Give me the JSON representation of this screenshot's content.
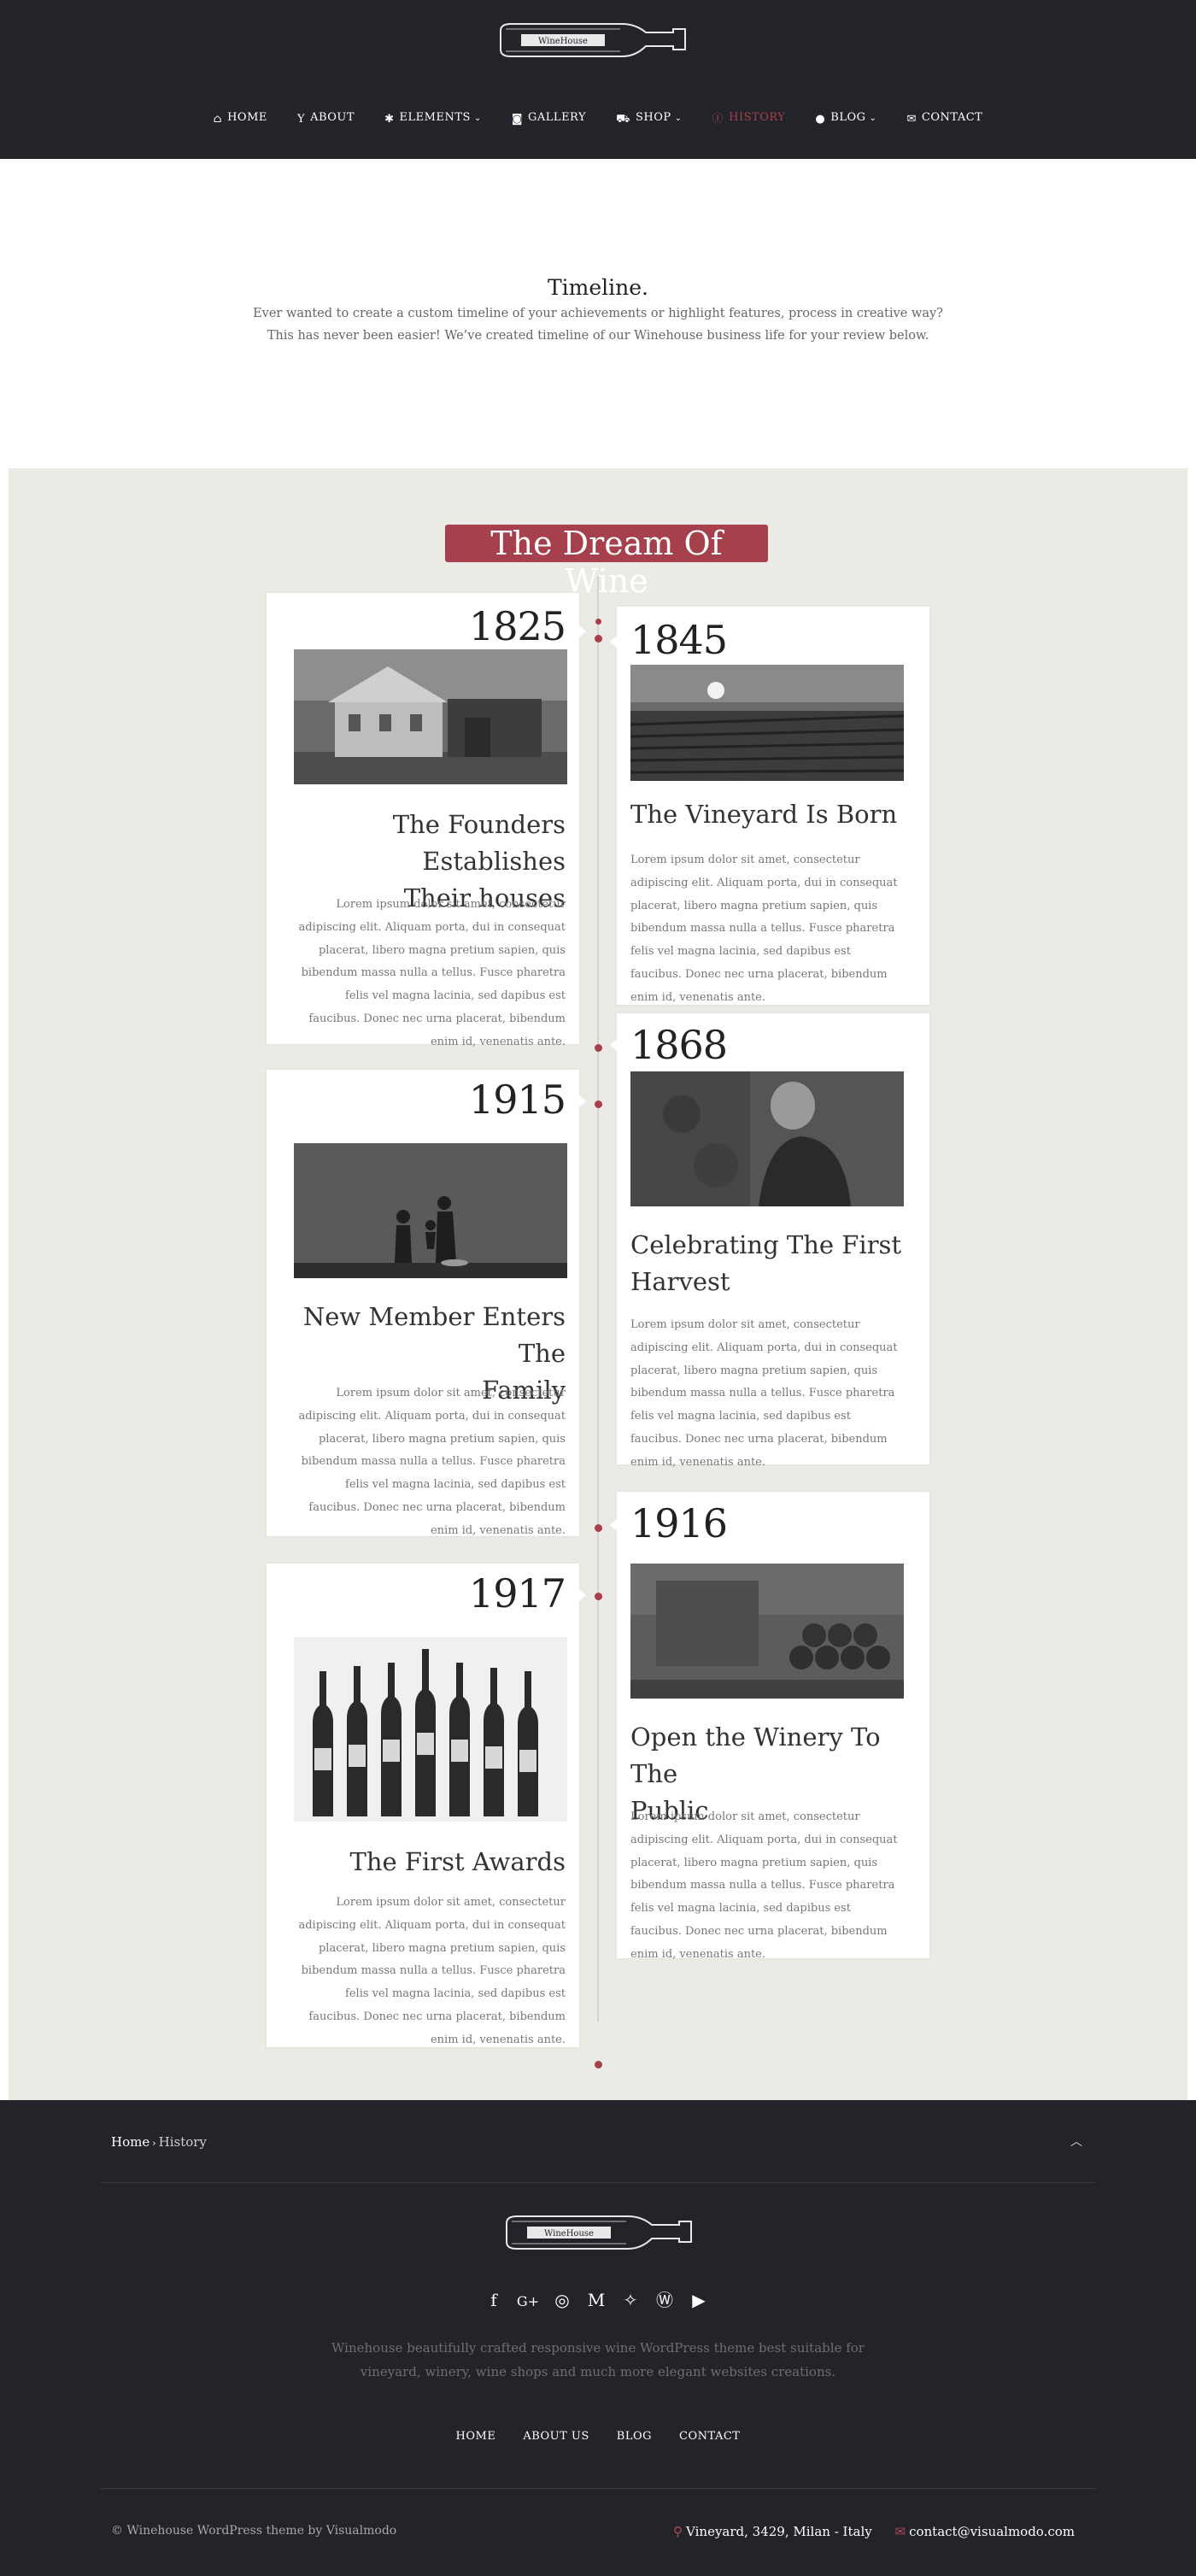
{
  "brand": {
    "logo_text": "WineHouse"
  },
  "nav": {
    "items": [
      {
        "label": "HOME",
        "icon": "home-icon"
      },
      {
        "label": "ABOUT",
        "icon": "glass-icon"
      },
      {
        "label": "ELEMENTS",
        "icon": "gear-icon",
        "has_dropdown": true
      },
      {
        "label": "GALLERY",
        "icon": "camera-icon"
      },
      {
        "label": "SHOP",
        "icon": "cart-icon",
        "has_dropdown": true
      },
      {
        "label": "HISTORY",
        "icon": "info-icon",
        "active": true
      },
      {
        "label": "BLOG",
        "icon": "comment-icon",
        "has_dropdown": true
      },
      {
        "label": "CONTACT",
        "icon": "envelope-icon"
      }
    ],
    "active_color": "#a6404d"
  },
  "intro": {
    "title": "Timeline.",
    "line1": "Ever wanted to create a custom timeline of your achievements or highlight features, process in creative way?",
    "line2": "This has never been easier! We’ve created timeline of our Winehouse business life for your review below."
  },
  "timeline": {
    "heading": "The Dream Of Wine",
    "accent_color": "#a6404d",
    "events": [
      {
        "year": "1825",
        "title_line1": "The Founders Establishes",
        "title_line2": "Their houses",
        "image": "farmhouse-photo",
        "text": "Lorem ipsum dolor sit amet, consectetur adipiscing elit. Aliquam porta, dui in consequat placerat, libero magna pretium sapien, quis bibendum massa nulla a tellus. Fusce pharetra felis vel magna lacinia, sed dapibus est faucibus. Donec nec urna placerat, bibendum enim id, venenatis ante."
      },
      {
        "year": "1845",
        "title_line1": "The Vineyard Is Born",
        "title_line2": "",
        "image": "vineyard-sunset-photo",
        "text": "Lorem ipsum dolor sit amet, consectetur adipiscing elit. Aliquam porta, dui in consequat placerat, libero magna pretium sapien, quis bibendum massa nulla a tellus. Fusce pharetra felis vel magna lacinia, sed dapibus est faucibus. Donec nec urna placerat, bibendum enim id, venenatis ante."
      },
      {
        "year": "1868",
        "title_line1": "Celebrating The First",
        "title_line2": "Harvest",
        "image": "harvest-photo",
        "text": "Lorem ipsum dolor sit amet, consectetur adipiscing elit. Aliquam porta, dui in consequat placerat, libero magna pretium sapien, quis bibendum massa nulla a tellus. Fusce pharetra felis vel magna lacinia, sed dapibus est faucibus. Donec nec urna placerat, bibendum enim id, venenatis ante."
      },
      {
        "year": "1915",
        "title_line1": "New Member Enters The",
        "title_line2": "Family",
        "image": "family-silhouette-photo",
        "text": "Lorem ipsum dolor sit amet, consectetur adipiscing elit. Aliquam porta, dui in consequat placerat, libero magna pretium sapien, quis bibendum massa nulla a tellus. Fusce pharetra felis vel magna lacinia, sed dapibus est faucibus. Donec nec urna placerat, bibendum enim id, venenatis ante."
      },
      {
        "year": "1916",
        "title_line1": "Open the Winery To The",
        "title_line2": "Public",
        "image": "wine-cellar-photo",
        "text": "Lorem ipsum dolor sit amet, consectetur adipiscing elit. Aliquam porta, dui in consequat placerat, libero magna pretium sapien, quis bibendum massa nulla a tellus. Fusce pharetra felis vel magna lacinia, sed dapibus est faucibus. Donec nec urna placerat, bibendum enim id, venenatis ante."
      },
      {
        "year": "1917",
        "title_line1": "The First Awards",
        "title_line2": "",
        "image": "wine-bottles-photo",
        "text": "Lorem ipsum dolor sit amet, consectetur adipiscing elit. Aliquam porta, dui in consequat placerat, libero magna pretium sapien, quis bibendum massa nulla a tellus. Fusce pharetra felis vel magna lacinia, sed dapibus est faucibus. Donec nec urna placerat, bibendum enim id, venenatis ante."
      }
    ]
  },
  "footer": {
    "breadcrumb": {
      "home": "Home",
      "separator": "›",
      "current": "History"
    },
    "to_top_icon": "chevron-up-icon",
    "social": [
      "facebook-icon",
      "google-plus-icon",
      "instagram-icon",
      "medium-icon",
      "twitter-icon",
      "wordpress-icon",
      "youtube-icon"
    ],
    "about_line1": "Winehouse beautifully crafted responsive wine WordPress theme best suitable for",
    "about_line2": "vineyard, winery, wine shops and much more elegant websites creations.",
    "nav": [
      "HOME",
      "ABOUT US",
      "BLOG",
      "CONTACT"
    ],
    "copyright": "© Winehouse WordPress theme by Visualmodo",
    "address": "Vineyard, 3429, Milan - Italy",
    "email": "contact@visualmodo.com"
  }
}
